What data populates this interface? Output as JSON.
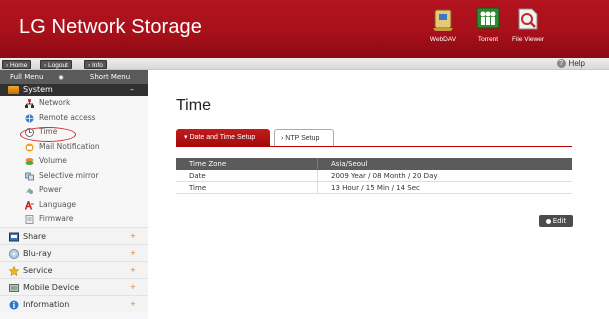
{
  "app": {
    "title": "LG Network Storage"
  },
  "header_buttons": [
    {
      "label": "WebDAV",
      "icon": "webdav-icon"
    },
    {
      "label": "Torrent",
      "icon": "torrent-icon"
    },
    {
      "label": "File Viewer",
      "icon": "file-viewer-icon"
    }
  ],
  "toolbar": {
    "home_label": "Home",
    "logout_label": "Logout",
    "info_label": "Info",
    "help_label": "Help"
  },
  "sidebar": {
    "tabs": {
      "full": "Full Menu",
      "short": "Short Menu"
    },
    "system": {
      "label": "System",
      "items": [
        {
          "label": "Network",
          "icon": "network-icon"
        },
        {
          "label": "Remote access",
          "icon": "remote-access-icon"
        },
        {
          "label": "Time",
          "icon": "clock-icon"
        },
        {
          "label": "Mail Notification",
          "icon": "mail-icon"
        },
        {
          "label": "Volume",
          "icon": "volume-icon"
        },
        {
          "label": "Selective mirror",
          "icon": "mirror-icon"
        },
        {
          "label": "Power",
          "icon": "power-icon"
        },
        {
          "label": "Language",
          "icon": "language-icon"
        },
        {
          "label": "Firmware",
          "icon": "firmware-icon"
        }
      ]
    },
    "categories": [
      {
        "label": "Share",
        "icon": "share-icon"
      },
      {
        "label": "Blu-ray",
        "icon": "bluray-icon"
      },
      {
        "label": "Service",
        "icon": "service-icon"
      },
      {
        "label": "Mobile Device",
        "icon": "mobile-device-icon"
      },
      {
        "label": "Information",
        "icon": "information-icon"
      }
    ]
  },
  "main": {
    "title": "Time",
    "tabs": [
      {
        "label": "Date and Time Setup",
        "active": true
      },
      {
        "label": "NTP Setup",
        "active": false
      }
    ],
    "table": {
      "header": {
        "key": "Time Zone",
        "value": "Asia/Seoul"
      },
      "rows": [
        {
          "key": "Date",
          "value": "2009 Year / 08 Month / 20 Day"
        },
        {
          "key": "Time",
          "value": "13 Hour / 15 Min / 14 Sec"
        }
      ]
    },
    "edit_label": "Edit"
  },
  "colors": {
    "brand_red": "#b3141f",
    "active_tab": "#c41b1b",
    "header_row": "#5b5b5b"
  }
}
